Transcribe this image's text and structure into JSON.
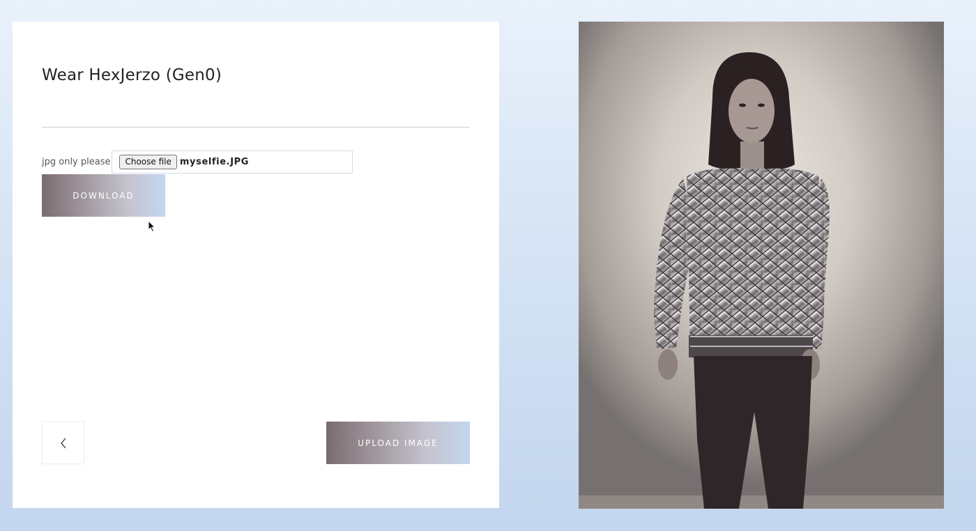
{
  "form": {
    "title": "Wear HexJerzo (Gen0)",
    "file_label": "jpg only please",
    "choose_file_label": "Choose file",
    "file_name": "myselfie.JPG",
    "download_label": "DOWNLOAD",
    "upload_label": "UPLOAD IMAGE",
    "back_icon": "chevron-left-icon"
  },
  "preview": {
    "description_alt": "Photo of person wearing HexJerzo sweater"
  },
  "colors": {
    "background": "#d6e4f5",
    "card": "#ffffff",
    "button_gradient_start": "#7b6b70",
    "button_gradient_end": "#c4d6ee"
  }
}
